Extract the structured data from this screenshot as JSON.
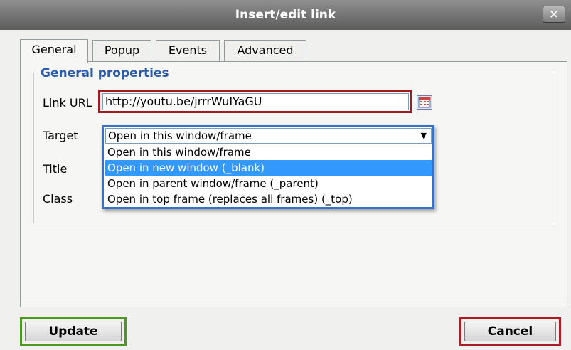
{
  "window": {
    "title": "Insert/edit link",
    "close_label": "✕"
  },
  "tabs": [
    {
      "label": "General",
      "active": true
    },
    {
      "label": "Popup",
      "active": false
    },
    {
      "label": "Events",
      "active": false
    },
    {
      "label": "Advanced",
      "active": false
    }
  ],
  "general": {
    "legend": "General properties",
    "link_url_label": "Link URL",
    "link_url_value": "http://youtu.be/jrrrWuIYaGU",
    "target_label": "Target",
    "title_label": "Title",
    "class_label": "Class",
    "target_selected": "Open in this window/frame",
    "target_options": [
      "Open in this window/frame",
      "Open in new window (_blank)",
      "Open in parent window/frame (_parent)",
      "Open in top frame (replaces all frames) (_top)"
    ],
    "highlighted_option_index": 1
  },
  "buttons": {
    "update": "Update",
    "cancel": "Cancel"
  },
  "colors": {
    "url_highlight": "#9e1b22",
    "dropdown_highlight": "#3a6fc7",
    "update_highlight": "#4a9a1e",
    "cancel_highlight": "#b01c26",
    "legend": "#2b5aa8",
    "selected_option": "#3399ff"
  },
  "icons": {
    "browse": "calendar-browse-icon",
    "close": "close-icon",
    "dropdown": "chevron-down-icon"
  }
}
